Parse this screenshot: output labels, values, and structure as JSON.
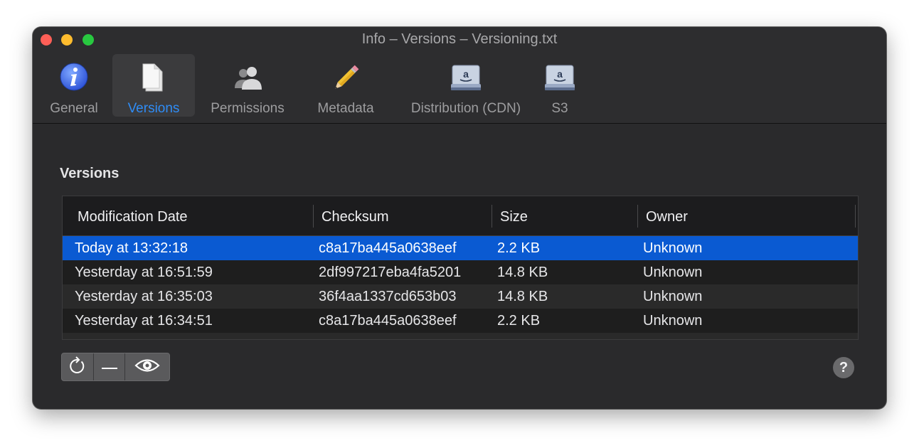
{
  "window": {
    "title": "Info – Versions – Versioning.txt"
  },
  "toolbar": {
    "items": [
      {
        "label": "General",
        "icon": "info-icon",
        "selected": false
      },
      {
        "label": "Versions",
        "icon": "document-icon",
        "selected": true
      },
      {
        "label": "Permissions",
        "icon": "users-icon",
        "selected": false
      },
      {
        "label": "Metadata",
        "icon": "pencil-icon",
        "selected": false
      },
      {
        "label": "Distribution (CDN)",
        "icon": "amazon-drive-icon",
        "selected": false
      },
      {
        "label": "S3",
        "icon": "amazon-drive-icon",
        "selected": false
      }
    ]
  },
  "section": {
    "title": "Versions"
  },
  "table": {
    "columns": [
      "Modification Date",
      "Checksum",
      "Size",
      "Owner"
    ],
    "rows": [
      {
        "date": "Today at 13:32:18",
        "checksum": "c8a17ba445a0638eef",
        "size": "2.2 KB",
        "owner": "Unknown",
        "selected": true
      },
      {
        "date": "Yesterday at 16:51:59",
        "checksum": "2df997217eba4fa5201",
        "size": "14.8 KB",
        "owner": "Unknown",
        "selected": false
      },
      {
        "date": "Yesterday at 16:35:03",
        "checksum": "36f4aa1337cd653b03",
        "size": "14.8 KB",
        "owner": "Unknown",
        "selected": false
      },
      {
        "date": "Yesterday at 16:34:51",
        "checksum": "c8a17ba445a0638eef",
        "size": "2.2 KB",
        "owner": "Unknown",
        "selected": false
      }
    ]
  },
  "bottom_bar": {
    "buttons": [
      "revert-icon",
      "remove-icon",
      "quicklook-eye-icon"
    ],
    "help_label": "?"
  },
  "colors": {
    "accent": "#2f8cf5",
    "selection": "#0a5ad2",
    "window_bg": "#2a2a2c"
  }
}
